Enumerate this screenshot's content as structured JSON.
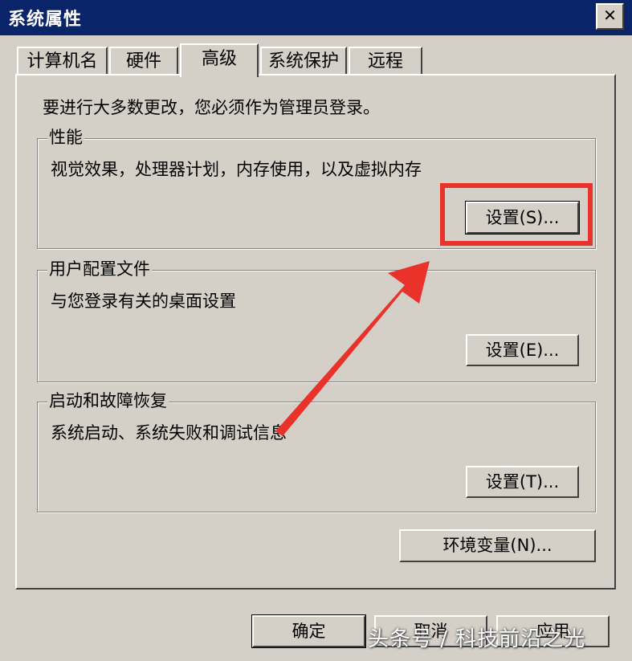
{
  "window": {
    "title": "系统属性",
    "close_glyph": "✕"
  },
  "tabs": [
    {
      "label": "计算机名",
      "active": false
    },
    {
      "label": "硬件",
      "active": false
    },
    {
      "label": "高级",
      "active": true
    },
    {
      "label": "系统保护",
      "active": false
    },
    {
      "label": "远程",
      "active": false
    }
  ],
  "intro": "要进行大多数更改，您必须作为管理员登录。",
  "groups": {
    "performance": {
      "title": "性能",
      "desc": "视觉效果，处理器计划，内存使用，以及虚拟内存",
      "button": "设置(S)..."
    },
    "user_profiles": {
      "title": "用户配置文件",
      "desc": "与您登录有关的桌面设置",
      "button": "设置(E)..."
    },
    "startup_recovery": {
      "title": "启动和故障恢复",
      "desc": "系统启动、系统失败和调试信息",
      "button": "设置(T)..."
    }
  },
  "env_button": "环境变量(N)...",
  "footer": {
    "ok": "确定",
    "cancel": "取消",
    "apply": "应用"
  },
  "annotation": {
    "highlight_color": "#e8322a"
  },
  "watermark": "头条号 / 科技前沿之光"
}
